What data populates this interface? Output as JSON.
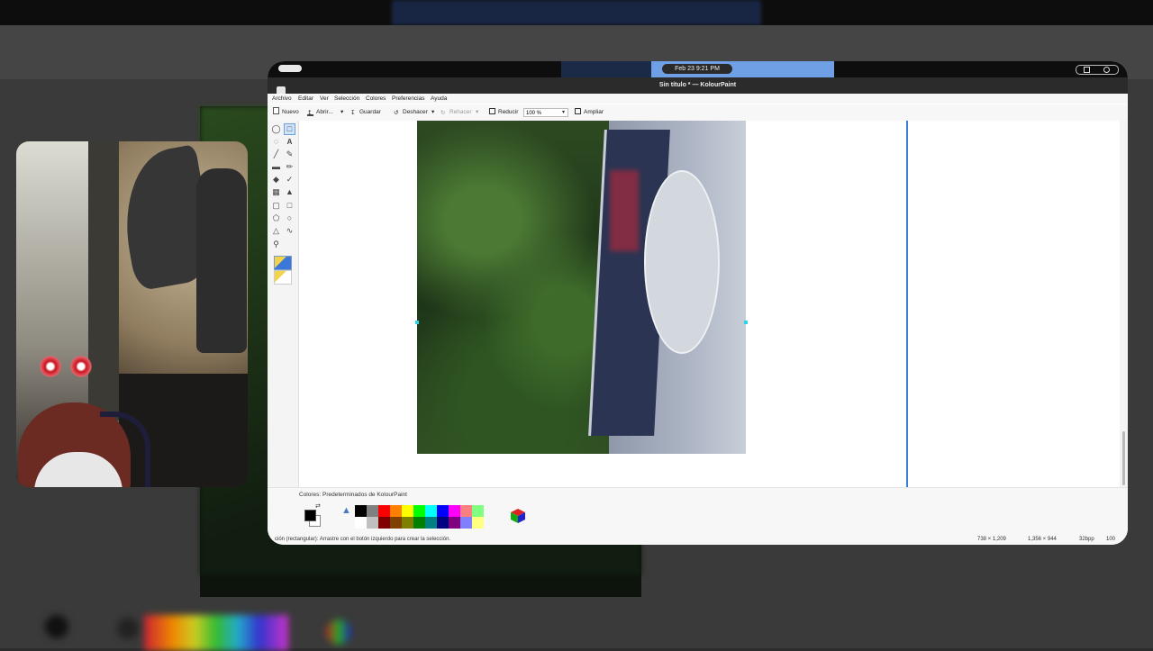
{
  "clock": "Feb 23   9:21 PM",
  "window_title": "Sin título * — KolourPaint",
  "menu": [
    "Archivo",
    "Editar",
    "Ver",
    "Selección",
    "Colores",
    "Preferencias",
    "Ayuda"
  ],
  "toolbar": {
    "new_label": "Nuevo",
    "open_label": "Abrir...",
    "save_label": "Guardar",
    "undo_label": "Deshacer",
    "redo_label": "Rehacer",
    "zoom_out_label": "Reducir",
    "zoom_value": "100 %",
    "zoom_in_label": "Ampliar"
  },
  "tools": [
    "free-select-icon",
    "rect-select-icon",
    "ellipse-select-icon",
    "text-icon",
    "line-icon",
    "pen-icon",
    "eraser-icon",
    "brush-icon",
    "fill-icon",
    "color-picker-icon",
    "color-eraser-icon",
    "airbrush-icon",
    "rectangle-icon",
    "rounded-rect-icon",
    "polygon-icon",
    "ellipse-icon",
    "connected-lines-icon",
    "curve-icon",
    "zoom-icon"
  ],
  "colors": {
    "label": "Colores: Predeterminados de KolourPaint",
    "foreground": "#000000",
    "background": "#ffffff",
    "palette_row1": [
      "#000000",
      "#808080",
      "#ff0000",
      "#ff8000",
      "#ffff00",
      "#00ff00",
      "#00ffff",
      "#0000ff",
      "#ff00ff",
      "#ff8080",
      "#80ff80"
    ],
    "palette_row2": [
      "#ffffff",
      "#c0c0c0",
      "#800000",
      "#804000",
      "#808000",
      "#008000",
      "#008080",
      "#000080",
      "#800080",
      "#8080ff",
      "#ffff80"
    ]
  },
  "status": {
    "message": "ción (rectangular): Arrastre con el botón izquierdo para crear la selección.",
    "selection_size": "738 × 1,209",
    "image_size": "1,356 × 944",
    "depth": "32bpp",
    "zoom": "100"
  }
}
